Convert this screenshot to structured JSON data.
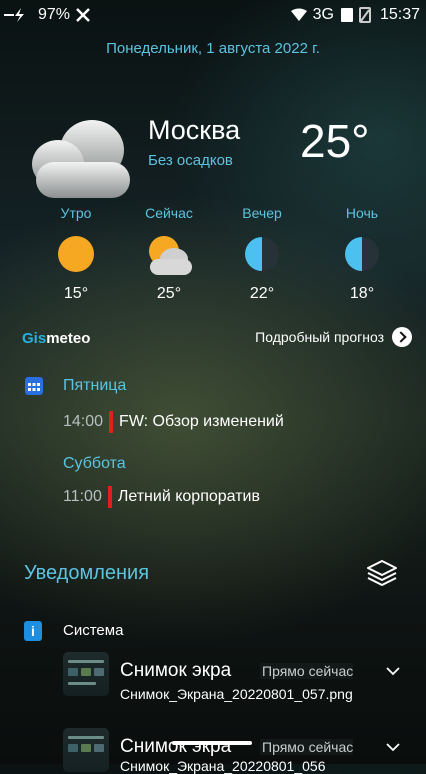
{
  "status_bar": {
    "battery": "97%",
    "network": "3G",
    "time": "15:37"
  },
  "date": "Понедельник, 1 августа 2022 г.",
  "weather": {
    "city": "Москва",
    "description": "Без осадков",
    "temperature": "25°",
    "forecast": [
      {
        "label": "Утро",
        "icon": "sun-icon",
        "temp": "15°"
      },
      {
        "label": "Сейчас",
        "icon": "partly-cloudy-icon",
        "temp": "25°"
      },
      {
        "label": "Вечер",
        "icon": "half-moon-icon",
        "temp": "22°"
      },
      {
        "label": "Ночь",
        "icon": "half-moon-icon",
        "temp": "18°"
      }
    ],
    "brand_prefix": "Gis",
    "brand_suffix": "meteo",
    "details_link": "Подробный прогноз"
  },
  "calendar": {
    "days": [
      {
        "day": "Пятница",
        "events": [
          {
            "time": "14:00",
            "title": "FW: Обзор изменений"
          }
        ]
      },
      {
        "day": "Суббота",
        "events": [
          {
            "time": "11:00",
            "title": "Летний корпоратив"
          }
        ]
      }
    ]
  },
  "notifications": {
    "header": "Уведомления",
    "group": "Система",
    "items": [
      {
        "title": "Снимок экра",
        "time": "Прямо сейчас",
        "subtitle": "Снимок_Экрана_20220801_057.png"
      },
      {
        "title": "Снимок экра",
        "time": "Прямо сейчас",
        "subtitle": "Снимок_Экрана_20220801_056"
      }
    ]
  },
  "colors": {
    "accent": "#5cc3e0",
    "sun": "#f7a823",
    "event_bar": "#e0201b"
  }
}
